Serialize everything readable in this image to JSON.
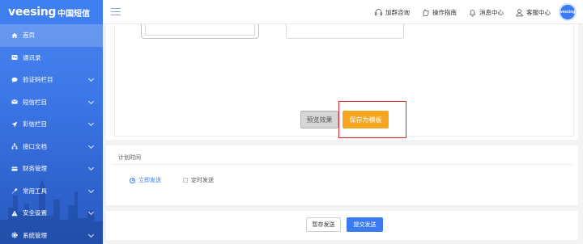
{
  "brand": {
    "name": "veesing",
    "subtitle": "中国短信"
  },
  "sidebar": {
    "items": [
      {
        "label": "首页",
        "icon": "home-icon"
      },
      {
        "label": "通讯录",
        "icon": "contacts-icon"
      },
      {
        "label": "验证码栏目",
        "icon": "chat-icon"
      },
      {
        "label": "短信栏目",
        "icon": "mail-icon"
      },
      {
        "label": "彩信栏目",
        "icon": "send-icon"
      },
      {
        "label": "接口文档",
        "icon": "sitemap-icon"
      },
      {
        "label": "财务管理",
        "icon": "card-icon"
      },
      {
        "label": "常用工具",
        "icon": "wrench-icon"
      },
      {
        "label": "安全设置",
        "icon": "warning-icon"
      },
      {
        "label": "系统管理",
        "icon": "gear-icon"
      }
    ]
  },
  "header": {
    "links": [
      {
        "label": "加群咨询",
        "icon": "headset-icon"
      },
      {
        "label": "操作指南",
        "icon": "guide-icon"
      },
      {
        "label": "消息中心",
        "icon": "bell-icon"
      },
      {
        "label": "客服中心",
        "icon": "user-icon"
      }
    ],
    "avatar_text": "veesing"
  },
  "editor": {
    "preview_label": "预览效果",
    "save_template_label": "保存为模板"
  },
  "schedule": {
    "title": "计划时间",
    "options": [
      {
        "label": "立即发送",
        "checked": true
      },
      {
        "label": "定时发送",
        "checked": false
      }
    ]
  },
  "actions": {
    "draft_label": "暂存发送",
    "submit_label": "提交发送"
  },
  "colors": {
    "sidebar": "#3c77e6",
    "accent": "#3a7bf2",
    "warning": "#f5a623",
    "highlight": "#e02020"
  }
}
